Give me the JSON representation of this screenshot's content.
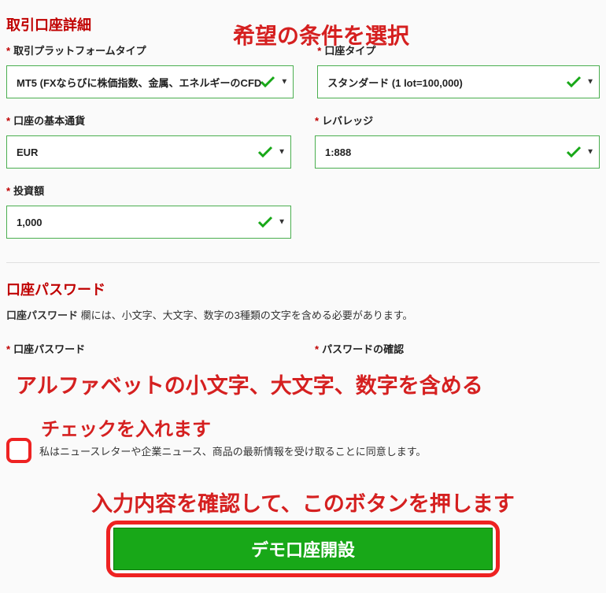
{
  "sections": {
    "details_title": "取引口座詳細",
    "password_title": "口座パスワード"
  },
  "fields": {
    "platform": {
      "label": "取引プラットフォームタイプ",
      "value": "MT5 (FXならびに株価指数、金属、エネルギーのCFD"
    },
    "account_type": {
      "label": "口座タイプ",
      "value": "スタンダード (1 lot=100,000)"
    },
    "base_currency": {
      "label": "口座の基本通貨",
      "value": "EUR"
    },
    "leverage": {
      "label": "レバレッジ",
      "value": "1:888"
    },
    "investment": {
      "label": "投資額",
      "value": "1,000"
    },
    "password": {
      "label": "口座パスワード"
    },
    "password_confirm": {
      "label": "パスワードの確認"
    }
  },
  "password_desc_strong": "口座パスワード",
  "password_desc_rest": " 欄には、小文字、大文字、数字の3種類の文字を含める必要があります。",
  "consent_text": "私はニュースレターや企業ニュース、商品の最新情報を受け取ることに同意します。",
  "submit_label": "デモ口座開設",
  "annotations": {
    "top": "希望の条件を選択",
    "password": "アルファベットの小文字、大文字、数字を含める",
    "check": "チェックを入れます",
    "confirm": "入力内容を確認して、このボタンを押します"
  },
  "required_mark": "*"
}
